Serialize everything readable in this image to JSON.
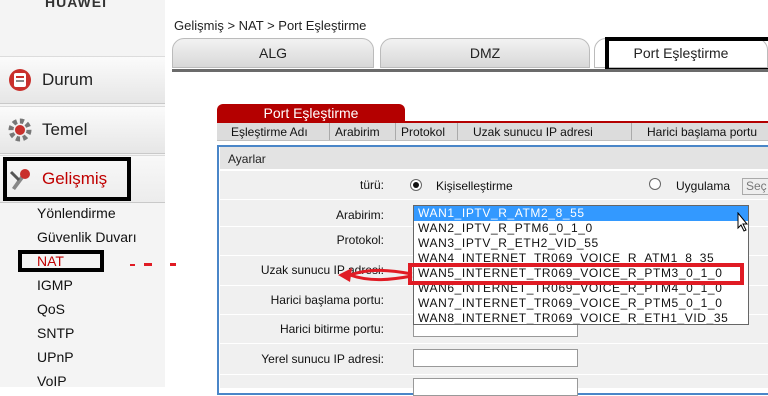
{
  "brand": "HUAWEI",
  "sidebar": {
    "items": [
      {
        "label": "Durum",
        "icon": "status-icon"
      },
      {
        "label": "Temel",
        "icon": "gear-icon"
      },
      {
        "label": "Gelişmiş",
        "icon": "advanced-tools-icon"
      }
    ],
    "submenu": [
      "Yönlendirme",
      "Güvenlik Duvarı",
      "NAT",
      "IGMP",
      "QoS",
      "SNTP",
      "UPnP",
      "VoIP"
    ]
  },
  "breadcrumb": "Gelişmiş > NAT > Port Eşleştirme",
  "tabs": [
    "ALG",
    "DMZ",
    "Port Eşleştirme"
  ],
  "section_title": "Port Eşleştirme",
  "columns": [
    "Eşleştirme Adı",
    "Arabirim",
    "Protokol",
    "Uzak sunucu IP adresi",
    "Harici başlama portu"
  ],
  "settings": {
    "header": "Ayarlar",
    "type_label": "türü:",
    "type_options": [
      "Kişiselleştirme",
      "Uygulama"
    ],
    "type_selected": "Kişiselleştirme",
    "app_select_placeholder": "Seç",
    "interface_label": "Arabirim:",
    "protocol_label": "Protokol:",
    "remote_host_label": "Uzak sunucu IP adresi:",
    "ext_start_label": "Harici başlama portu:",
    "ext_end_label": "Harici bitirme portu:",
    "local_ip_label": "Yerel sunucu IP adresi:"
  },
  "interface_options": [
    "WAN1_IPTV_R_ATM2_8_55",
    "WAN2_IPTV_R_PTM6_0_1_0",
    "WAN3_IPTV_R_ETH2_VID_55",
    "WAN4_INTERNET_TR069_VOICE_R_ATM1_8_35",
    "WAN5_INTERNET_TR069_VOICE_R_PTM3_0_1_0",
    "WAN6_INTERNET_TR069_VOICE_R_PTM4_0_1_0",
    "WAN7_INTERNET_TR069_VOICE_R_PTM5_0_1_0",
    "WAN8_INTERNET_TR069_VOICE_R_ETH1_VID_35"
  ],
  "interface_selected": "WAN1_IPTV_R_ATM2_8_55",
  "interface_highlighted": "WAN5_INTERNET_TR069_VOICE_R_PTM3_0_1_0",
  "colors": {
    "accent_red": "#b40000",
    "selection_blue": "#3399ff",
    "annotation_red": "#e01b24",
    "panel_border": "#4a86c8"
  }
}
